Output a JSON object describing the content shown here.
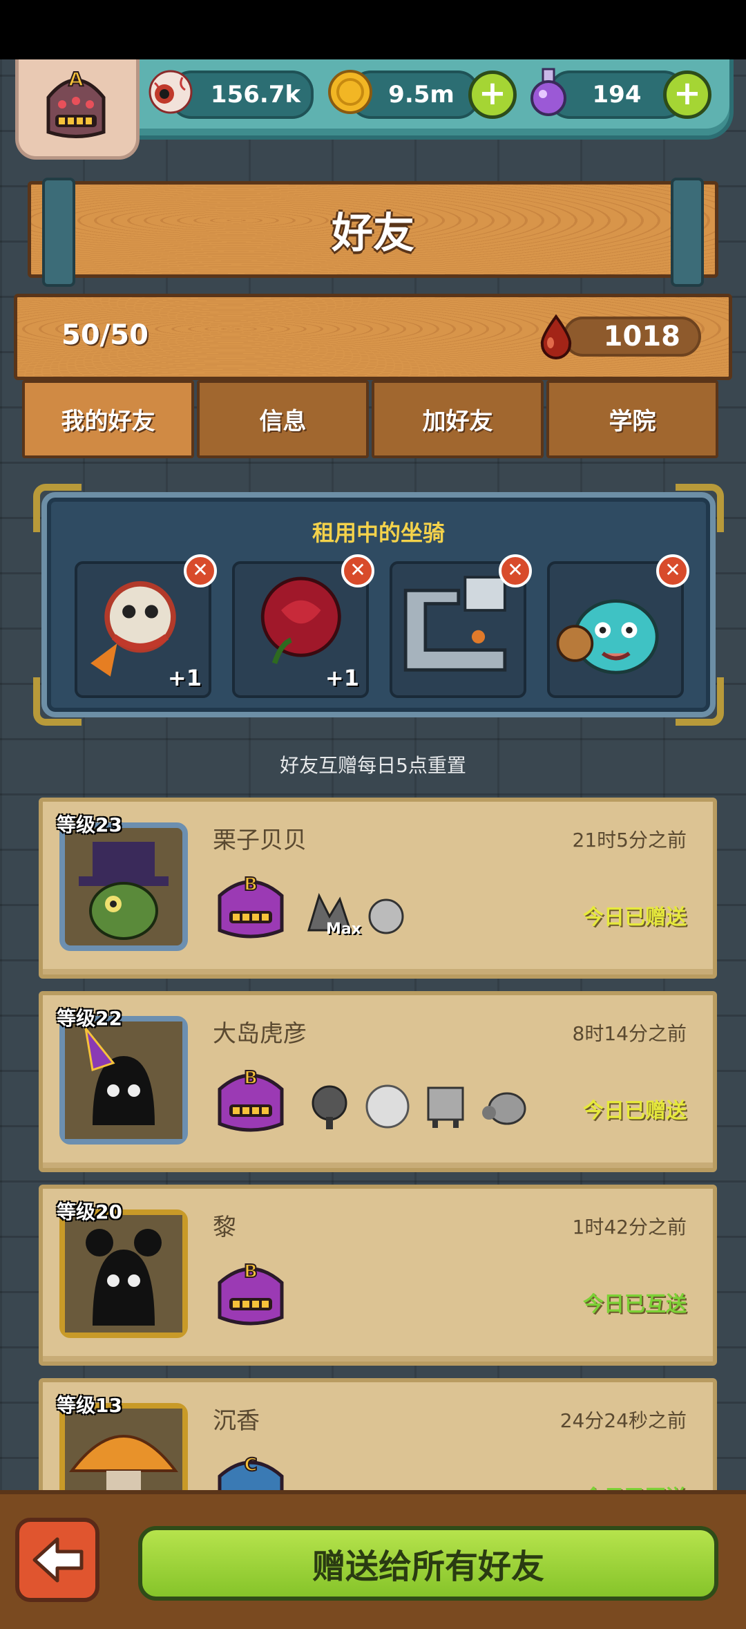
{
  "header": {
    "rank_badge": "A",
    "resources": [
      {
        "icon": "eyeball-icon",
        "value": "156.7k"
      },
      {
        "icon": "coin-icon",
        "value": "9.5m"
      },
      {
        "icon": "potion-icon",
        "value": "194"
      }
    ]
  },
  "page_title": "好友",
  "friends_count": "50/50",
  "blood_value": "1018",
  "tabs": [
    "我的好友",
    "信息",
    "加好友",
    "学院"
  ],
  "rental": {
    "title": "租用中的坐骑",
    "slots": [
      {
        "plus": "+1"
      },
      {
        "plus": "+1"
      },
      {
        "plus": ""
      },
      {
        "plus": ""
      }
    ]
  },
  "note": "好友互赠每日5点重置",
  "friends": [
    {
      "level": "等级23",
      "name": "栗子贝贝",
      "time": "21时5分之前",
      "status": "今日已赠送",
      "badge": "B",
      "max_label": "Max"
    },
    {
      "level": "等级22",
      "name": "大岛虎彦",
      "time": "8时14分之前",
      "status": "今日已赠送",
      "badge": "B"
    },
    {
      "level": "等级20",
      "name": "黎",
      "time": "1时42分之前",
      "status": "今日已互送",
      "badge": "B"
    },
    {
      "level": "等级13",
      "name": "沉香",
      "time": "24分24秒之前",
      "status": "今日已互送",
      "badge": "C"
    }
  ],
  "send_all_label": "赠送给所有好友",
  "colors": {
    "accent_green": "#a5d534",
    "wood": "#d08a44",
    "panel_blue": "#2f4b62"
  }
}
